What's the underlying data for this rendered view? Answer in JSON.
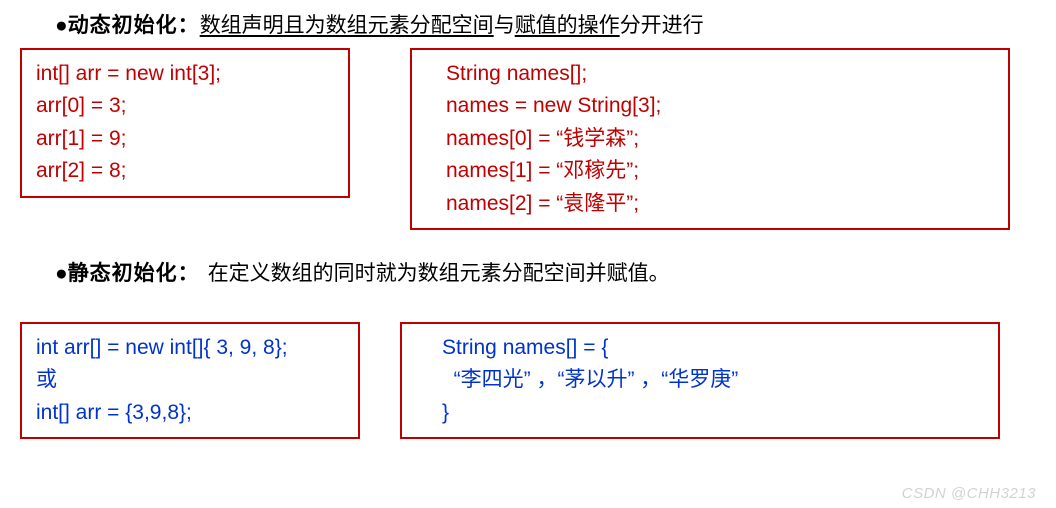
{
  "section1": {
    "bullet": "●",
    "title": "动态初始化：",
    "underlined": "数组声明且为数组元素分配空间",
    "mid": "与",
    "underlined2": "赋值的操作",
    "after": "分开进行"
  },
  "box1": {
    "l1": "int[] arr = new int[3];",
    "l2": "arr[0] = 3;",
    "l3": "arr[1] = 9;",
    "l4": "arr[2] = 8;"
  },
  "box2": {
    "l1": "String names[];",
    "l2": "names = new String[3];",
    "l3": "names[0] = “钱学森”;",
    "l4": "names[1] = “邓稼先”;",
    "l5": "names[2] = “袁隆平”;"
  },
  "section2": {
    "bullet": "●",
    "title": "静态初始化：",
    "desc": "在定义数组的同时就为数组元素分配空间并赋值。"
  },
  "box3": {
    "l1": "int arr[] = new int[]{ 3, 9, 8};",
    "l2": "或",
    "l3": "int[] arr = {3,9,8};"
  },
  "box4": {
    "l1": "String names[] = {",
    "l2": "  “李四光” ，“茅以升” ，“华罗庚”",
    "l3": "}"
  },
  "watermark": "CSDN @CHH3213"
}
